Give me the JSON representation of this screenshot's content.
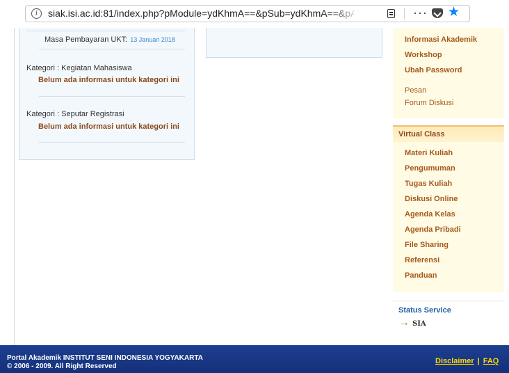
{
  "browser": {
    "url": "siak.isi.ac.id:81/index.php?pModule=ydKhmA==&pSub=ydKhmA==&pA",
    "icons": [
      "info-icon",
      "reader-view-icon",
      "more-icon",
      "pocket-icon",
      "bookmark-star-icon"
    ]
  },
  "left": {
    "ukt_label": "Masa Pembayaran UKT:",
    "ukt_date": "13 Januari 2018",
    "categories": [
      {
        "title": "Kategori : Kegiatan Mahasiswa",
        "message": "Belum ada informasi untuk kategori ini"
      },
      {
        "title": "Kategori : Seputar Registrasi",
        "message": "Belum ada informasi untuk kategori ini"
      }
    ]
  },
  "right": {
    "menu": [
      "Informasi Akademik",
      "Workshop",
      "Ubah Password"
    ],
    "small_links": [
      "Pesan",
      "Forum Diskusi"
    ],
    "virtual_class": {
      "title": "Virtual Class",
      "items": [
        "Materi Kuliah",
        "Pengumuman",
        "Tugas Kuliah",
        "Diskusi Online",
        "Agenda Kelas",
        "Agenda Pribadi",
        "File Sharing",
        "Referensi",
        "Panduan"
      ]
    },
    "status": {
      "title": "Status Service",
      "service": "SIA",
      "icon": "arrow-right-icon",
      "color": "#5cb82c"
    }
  },
  "footer": {
    "line1": "Portal Akademik INSTITUT SENI INDONESIA YOGYAKARTA",
    "line2": "© 2006 - 2009. All Right Reserved",
    "disclaimer": "Disclaimer",
    "separator": "|",
    "faq": "FAQ",
    "bg_color": "#1d3f8f",
    "link_color": "#ffd700"
  }
}
